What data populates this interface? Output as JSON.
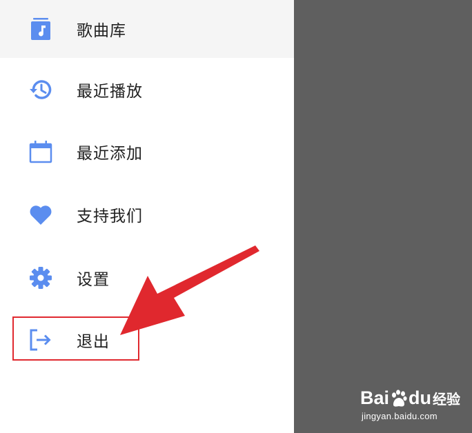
{
  "colors": {
    "icon_blue": "#5b8def",
    "text": "#212121",
    "scrim": "#5f5f5f",
    "annotation_red": "#e0282e",
    "selected_bg": "#f5f5f5"
  },
  "menu": {
    "items": [
      {
        "label": "歌曲库",
        "icon": "music-library-icon",
        "selected": true
      },
      {
        "label": "最近播放",
        "icon": "history-icon",
        "selected": false
      },
      {
        "label": "最近添加",
        "icon": "calendar-icon",
        "selected": false
      },
      {
        "label": "支持我们",
        "icon": "heart-icon",
        "selected": false
      },
      {
        "label": "设置",
        "icon": "gear-icon",
        "selected": false
      },
      {
        "label": "退出",
        "icon": "logout-icon",
        "selected": false
      }
    ]
  },
  "watermark": {
    "brand_left": "Bai",
    "brand_mid": "du",
    "brand_right": "经验",
    "url": "jingyan.baidu.com"
  }
}
